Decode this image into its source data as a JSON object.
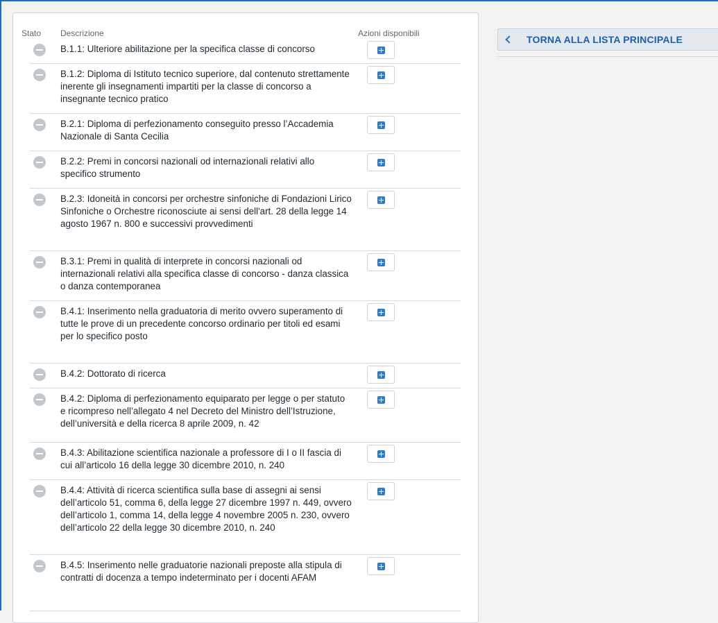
{
  "table": {
    "headers": {
      "stato": "Stato",
      "descrizione": "Descrizione",
      "azioni": "Azioni disponibili"
    },
    "rows": [
      {
        "description": "B.1.1: Ulteriore abilitazione per la specifica classe di concorso"
      },
      {
        "description": "B.1.2: Diploma di Istituto tecnico superiore, dal contenuto strettamente inerente gli insegnamenti impartiti per la classe di concorso a insegnante tecnico pratico"
      },
      {
        "description": "B.2.1: Diploma di perfezionamento conseguito presso l’Accademia Nazionale di Santa Cecilia"
      },
      {
        "description": "B.2.2: Premi in concorsi nazionali od internazionali relativi allo specifico strumento"
      },
      {
        "description": "B.2.3: Idoneità in concorsi per orchestre sinfoniche di Fondazioni Lirico Sinfoniche o Orchestre riconosciute ai sensi dell'art. 28 della legge 14 agosto 1967 n. 800 e successivi provvedimenti"
      },
      {
        "description": "B.3.1: Premi in qualità di interprete in concorsi nazionali od internazionali relativi alla specifica classe di concorso - danza classica o danza contemporanea"
      },
      {
        "description": "B.4.1: Inserimento nella graduatoria di merito ovvero superamento di tutte le prove di un precedente concorso ordinario per titoli ed esami per lo specifico posto"
      },
      {
        "description": "B.4.2: Dottorato di ricerca"
      },
      {
        "description": "B.4.2: Diploma di perfezionamento equiparato per legge o per statuto e ricompreso nell’allegato 4 nel Decreto del Ministro dell’Istruzione, dell’università e della ricerca 8 aprile 2009, n. 42"
      },
      {
        "description": "B.4.3: Abilitazione scientifica nazionale a professore di I o II fascia di cui all’articolo 16 della legge 30 dicembre 2010, n. 240"
      },
      {
        "description": "B.4.4: Attività di ricerca scientifica sulla base di assegni ai sensi dell’articolo 51, comma 6, della legge 27 dicembre 1997 n. 449, ovvero dell’articolo 1, comma 14, della legge 4 novembre 2005 n. 230, ovvero dell’articolo 22 della legge 30 dicembre 2010, n. 240"
      },
      {
        "description": "B.4.5: Inserimento nelle graduatorie nazionali preposte alla stipula di contratti di docenza a tempo indeterminato per i docenti AFAM"
      }
    ]
  },
  "nav": {
    "back_label": "TORNA ALLA LISTA PRINCIPALE"
  },
  "colors": {
    "accent": "#1b5fad",
    "frame": "#1a6fc4",
    "status_icon": "#c2c7cb",
    "plus_icon": "#2c7bcf"
  },
  "icons": {
    "status": "minus-circle-icon",
    "action": "plus-square-icon",
    "back": "chevron-left-icon"
  }
}
